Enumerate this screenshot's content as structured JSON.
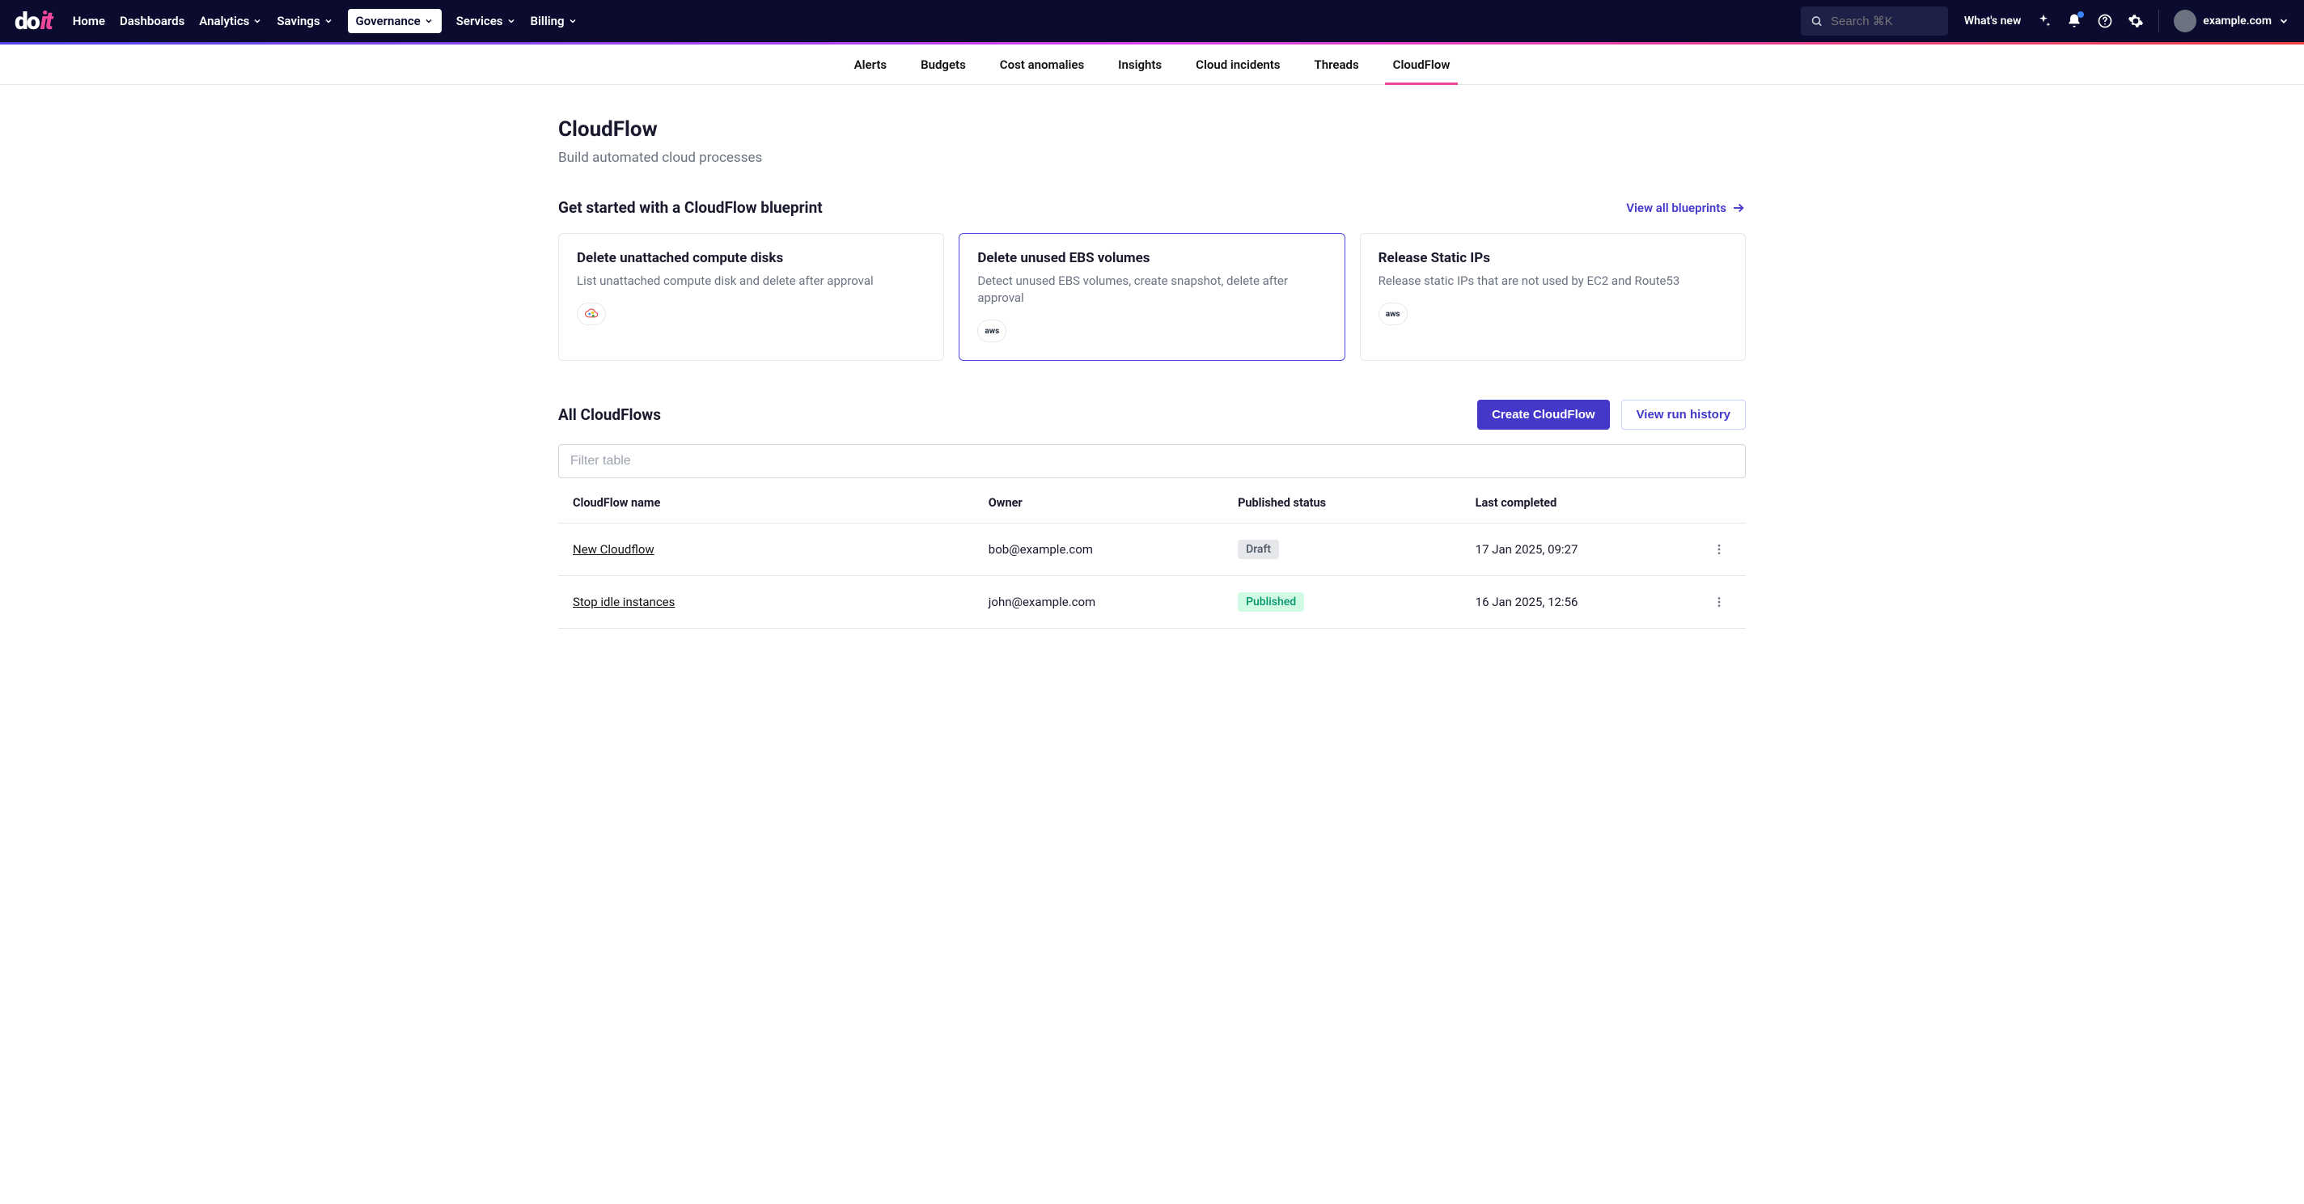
{
  "nav": {
    "logo_do": "do",
    "logo_it": "it",
    "items": [
      {
        "label": "Home",
        "dropdown": false,
        "active": false
      },
      {
        "label": "Dashboards",
        "dropdown": false,
        "active": false
      },
      {
        "label": "Analytics",
        "dropdown": true,
        "active": false
      },
      {
        "label": "Savings",
        "dropdown": true,
        "active": false
      },
      {
        "label": "Governance",
        "dropdown": true,
        "active": true
      },
      {
        "label": "Services",
        "dropdown": true,
        "active": false
      },
      {
        "label": "Billing",
        "dropdown": true,
        "active": false
      }
    ],
    "search_placeholder": "Search ⌘K",
    "whats_new": "What's new",
    "account_label": "example.com"
  },
  "subnav": {
    "items": [
      {
        "label": "Alerts",
        "active": false
      },
      {
        "label": "Budgets",
        "active": false
      },
      {
        "label": "Cost anomalies",
        "active": false
      },
      {
        "label": "Insights",
        "active": false
      },
      {
        "label": "Cloud incidents",
        "active": false
      },
      {
        "label": "Threads",
        "active": false
      },
      {
        "label": "CloudFlow",
        "active": true
      }
    ]
  },
  "page": {
    "title": "CloudFlow",
    "subtitle": "Build automated cloud processes",
    "blueprints_heading": "Get started with a CloudFlow blueprint",
    "view_all_label": "View all blueprints",
    "blueprints": [
      {
        "title": "Delete unattached compute disks",
        "desc": "List unattached compute disk and delete after approval",
        "cloud": "gcp",
        "selected": false
      },
      {
        "title": "Delete unused EBS volumes",
        "desc": "Detect unused EBS volumes, create snapshot, delete after approval",
        "cloud": "aws",
        "selected": true
      },
      {
        "title": "Release Static IPs",
        "desc": "Release static IPs that are not used by EC2 and Route53",
        "cloud": "aws",
        "selected": false
      }
    ],
    "table_heading": "All CloudFlows",
    "create_btn": "Create CloudFlow",
    "history_btn": "View run history",
    "filter_placeholder": "Filter table",
    "columns": {
      "name": "CloudFlow name",
      "owner": "Owner",
      "status": "Published status",
      "last": "Last completed"
    },
    "rows": [
      {
        "name": "New Cloudflow",
        "owner": "bob@example.com",
        "status": "Draft",
        "status_class": "chip-draft",
        "last": "17 Jan 2025, 09:27"
      },
      {
        "name": "Stop idle instances",
        "owner": "john@example.com",
        "status": "Published",
        "status_class": "chip-published",
        "last": "16 Jan 2025, 12:56"
      }
    ]
  }
}
